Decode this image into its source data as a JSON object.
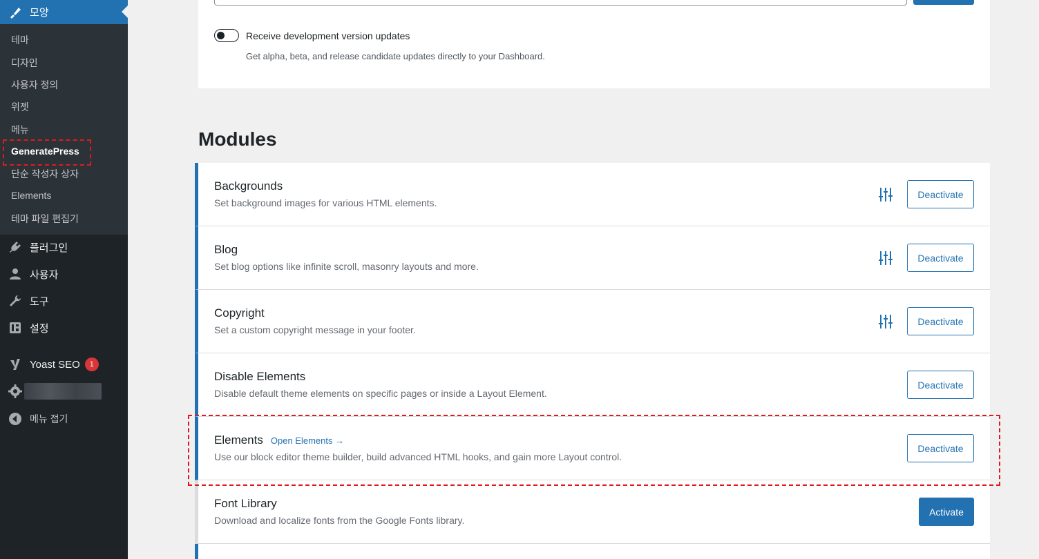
{
  "sidebar": {
    "active_menu": {
      "label": "모양",
      "icon": "brush-icon"
    },
    "submenu": [
      "테마",
      "디자인",
      "사용자 정의",
      "위젯",
      "메뉴",
      "GeneratePress",
      "단순 작성자 상자",
      "Elements",
      "테마 파일 편집기"
    ],
    "plugins": "플러그인",
    "users": "사용자",
    "tools": "도구",
    "settings": "설정",
    "yoast": "Yoast SEO",
    "yoast_badge": "1",
    "collapse": "메뉴 접기"
  },
  "updates": {
    "toggle_label": "Receive development version updates",
    "toggle_help": "Get alpha, beta, and release candidate updates directly to your Dashboard.",
    "toggle_on": false
  },
  "modules": {
    "title": "Modules",
    "items": [
      {
        "title": "Backgrounds",
        "desc": "Set background images for various HTML elements.",
        "button": "Deactivate",
        "link": ""
      },
      {
        "title": "Blog",
        "desc": "Set blog options like infinite scroll, masonry layouts and more.",
        "button": "Deactivate",
        "link": ""
      },
      {
        "title": "Copyright",
        "desc": "Set a custom copyright message in your footer.",
        "button": "Deactivate",
        "link": ""
      },
      {
        "title": "Disable Elements",
        "desc": "Disable default theme elements on specific pages or inside a Layout Element.",
        "button": "Deactivate",
        "link": ""
      },
      {
        "title": "Elements",
        "desc": "Use our block editor theme builder, build advanced HTML hooks, and gain more Layout control.",
        "button": "Deactivate",
        "link": "Open Elements →"
      },
      {
        "title": "Font Library",
        "desc": "Download and localize fonts from the Google Fonts library.",
        "button": "Activate",
        "link": ""
      }
    ]
  },
  "colors": {
    "accent": "#2271b1",
    "sidebar_bg": "#1d2327",
    "submenu_bg": "#2c3338",
    "highlight_dash": "#e0191e",
    "badge": "#d63638"
  }
}
